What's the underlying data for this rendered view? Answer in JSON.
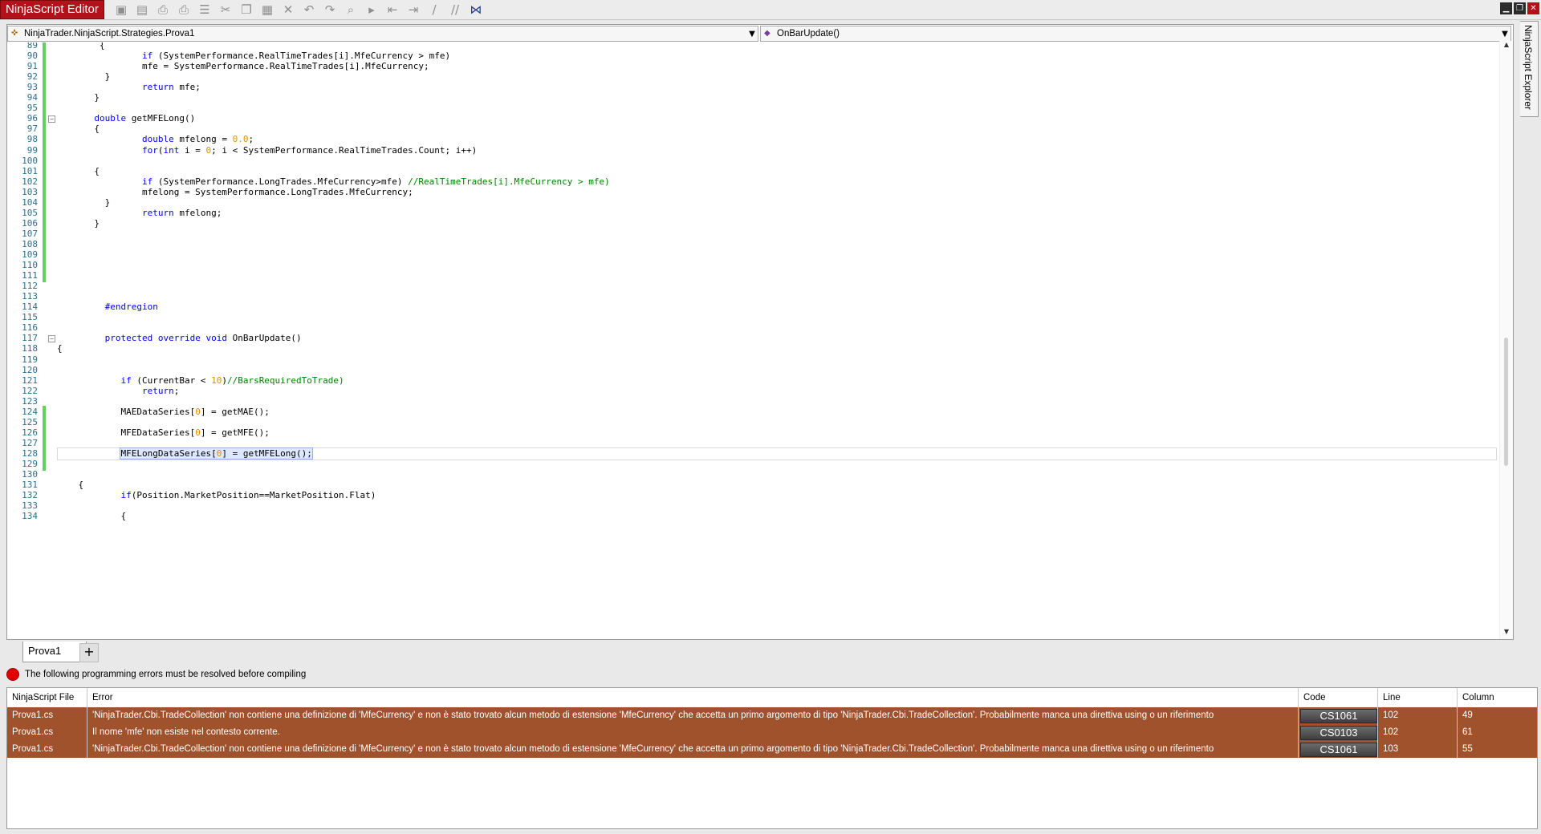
{
  "app_title": "NinjaScript Editor",
  "toolbar_icons": [
    "save-icon",
    "save-as-icon",
    "print-icon",
    "print-preview-icon",
    "template-icon",
    "cut-icon",
    "copy-icon",
    "paste-icon",
    "delete-icon",
    "undo-icon",
    "redo-icon",
    "find-icon",
    "compile-icon",
    "outdent-icon",
    "indent-icon",
    "comment-icon",
    "uncomment-icon",
    "visual-studio-icon"
  ],
  "class_selector": "NinjaTrader.NinjaScript.Strategies.Prova1",
  "member_selector": "OnBarUpdate()",
  "explorer_label": "NinjaScript Explorer",
  "code_lines": [
    {
      "n": "89",
      "t": "        {",
      "m": true
    },
    {
      "n": "90",
      "t": "                if (SystemPerformance.RealTimeTrades[i].MfeCurrency > mfe)",
      "m": true
    },
    {
      "n": "91",
      "t": "                mfe = SystemPerformance.RealTimeTrades[i].MfeCurrency;",
      "m": true
    },
    {
      "n": "92",
      "t": "         }",
      "m": true
    },
    {
      "n": "93",
      "t": "                return mfe;",
      "m": true
    },
    {
      "n": "94",
      "t": "       }",
      "m": true
    },
    {
      "n": "95",
      "t": "",
      "m": true
    },
    {
      "n": "96",
      "t": "       double getMFELong()",
      "m": true,
      "fold": true
    },
    {
      "n": "97",
      "t": "       {",
      "m": true
    },
    {
      "n": "98",
      "t": "                double mfelong = 0.0;",
      "m": true
    },
    {
      "n": "99",
      "t": "                for(int i = 0; i < SystemPerformance.RealTimeTrades.Count; i++)",
      "m": true
    },
    {
      "n": "100",
      "t": "",
      "m": true
    },
    {
      "n": "101",
      "t": "       {",
      "m": true
    },
    {
      "n": "102",
      "t": "                if (SystemPerformance.LongTrades.MfeCurrency>mfe) //RealTimeTrades[i].MfeCurrency > mfe)",
      "m": true
    },
    {
      "n": "103",
      "t": "                mfelong = SystemPerformance.LongTrades.MfeCurrency;",
      "m": true
    },
    {
      "n": "104",
      "t": "         }",
      "m": true
    },
    {
      "n": "105",
      "t": "                return mfelong;",
      "m": true
    },
    {
      "n": "106",
      "t": "       }",
      "m": true
    },
    {
      "n": "107",
      "t": "",
      "m": true
    },
    {
      "n": "108",
      "t": "",
      "m": true
    },
    {
      "n": "109",
      "t": "",
      "m": true
    },
    {
      "n": "110",
      "t": "",
      "m": true
    },
    {
      "n": "111",
      "t": "",
      "m": true
    },
    {
      "n": "112",
      "t": "",
      "m": false
    },
    {
      "n": "113",
      "t": "",
      "m": false
    },
    {
      "n": "114",
      "t": "         #endregion",
      "m": false
    },
    {
      "n": "115",
      "t": "",
      "m": false
    },
    {
      "n": "116",
      "t": "",
      "m": false
    },
    {
      "n": "117",
      "t": "         protected override void OnBarUpdate()",
      "m": false,
      "fold": true
    },
    {
      "n": "118",
      "t": "{",
      "m": false
    },
    {
      "n": "119",
      "t": "",
      "m": false
    },
    {
      "n": "120",
      "t": "",
      "m": false
    },
    {
      "n": "121",
      "t": "            if (CurrentBar < 10)//BarsRequiredToTrade)",
      "m": false
    },
    {
      "n": "122",
      "t": "                return;",
      "m": false
    },
    {
      "n": "123",
      "t": "",
      "m": false
    },
    {
      "n": "124",
      "t": "            MAEDataSeries[0] = getMAE();",
      "m": true
    },
    {
      "n": "125",
      "t": "",
      "m": true
    },
    {
      "n": "126",
      "t": "            MFEDataSeries[0] = getMFE();",
      "m": true
    },
    {
      "n": "127",
      "t": "",
      "m": true
    },
    {
      "n": "128",
      "t": "            MFELongDataSeries[0] = getMFELong();",
      "m": true,
      "cur": true
    },
    {
      "n": "129",
      "t": "",
      "m": true
    },
    {
      "n": "130",
      "t": "",
      "m": false
    },
    {
      "n": "131",
      "t": "    {",
      "m": false
    },
    {
      "n": "132",
      "t": "            if(Position.MarketPosition==MarketPosition.Flat)",
      "m": false
    },
    {
      "n": "133",
      "t": "",
      "m": false
    },
    {
      "n": "134",
      "t": "            {",
      "m": false
    }
  ],
  "tabs": [
    {
      "label": "Prova1"
    }
  ],
  "add_tab_label": "+",
  "status_message": "The following programming errors must be resolved before compiling",
  "error_table": {
    "headers": [
      "NinjaScript File",
      "Error",
      "Code",
      "Line",
      "Column"
    ],
    "rows": [
      {
        "file": "Prova1.cs",
        "error": "'NinjaTrader.Cbi.TradeCollection' non contiene una definizione di 'MfeCurrency' e non è stato trovato alcun metodo di estensione 'MfeCurrency' che accetta un primo argomento di tipo 'NinjaTrader.Cbi.TradeCollection'. Probabilmente manca una direttiva using o un riferimento",
        "code": "CS1061",
        "line": "102",
        "column": "49"
      },
      {
        "file": "Prova1.cs",
        "error": "Il nome 'mfe' non esiste nel contesto corrente.",
        "code": "CS0103",
        "line": "102",
        "column": "61"
      },
      {
        "file": "Prova1.cs",
        "error": "'NinjaTrader.Cbi.TradeCollection' non contiene una definizione di 'MfeCurrency' e non è stato trovato alcun metodo di estensione 'MfeCurrency' che accetta un primo argomento di tipo 'NinjaTrader.Cbi.TradeCollection'. Probabilmente manca una direttiva using o un riferimento",
        "code": "CS1061",
        "line": "103",
        "column": "55"
      }
    ]
  },
  "colors": {
    "accent": "#b3121a",
    "error_row": "#a0522d",
    "change_marker": "#5ed35e",
    "keyword": "#0000ff",
    "number": "#e09000",
    "comment": "#008000"
  }
}
